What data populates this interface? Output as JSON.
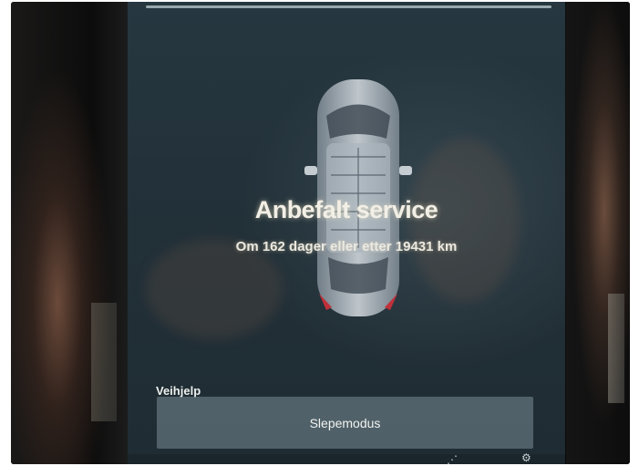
{
  "notification": {
    "headline": "Anbefalt service",
    "detail": "Om 162 dager eller etter 19431 km"
  },
  "roadside": {
    "label": "Veihjelp",
    "tow_mode_button": "Slepemodus"
  },
  "icons": {
    "car": "car-topview-icon",
    "settings": "settings-gear-icon",
    "signal": "signal-icon"
  },
  "colors": {
    "screen_bg": "#223038",
    "button_bg": "#7b8c96",
    "tail_light": "#c0303a"
  }
}
